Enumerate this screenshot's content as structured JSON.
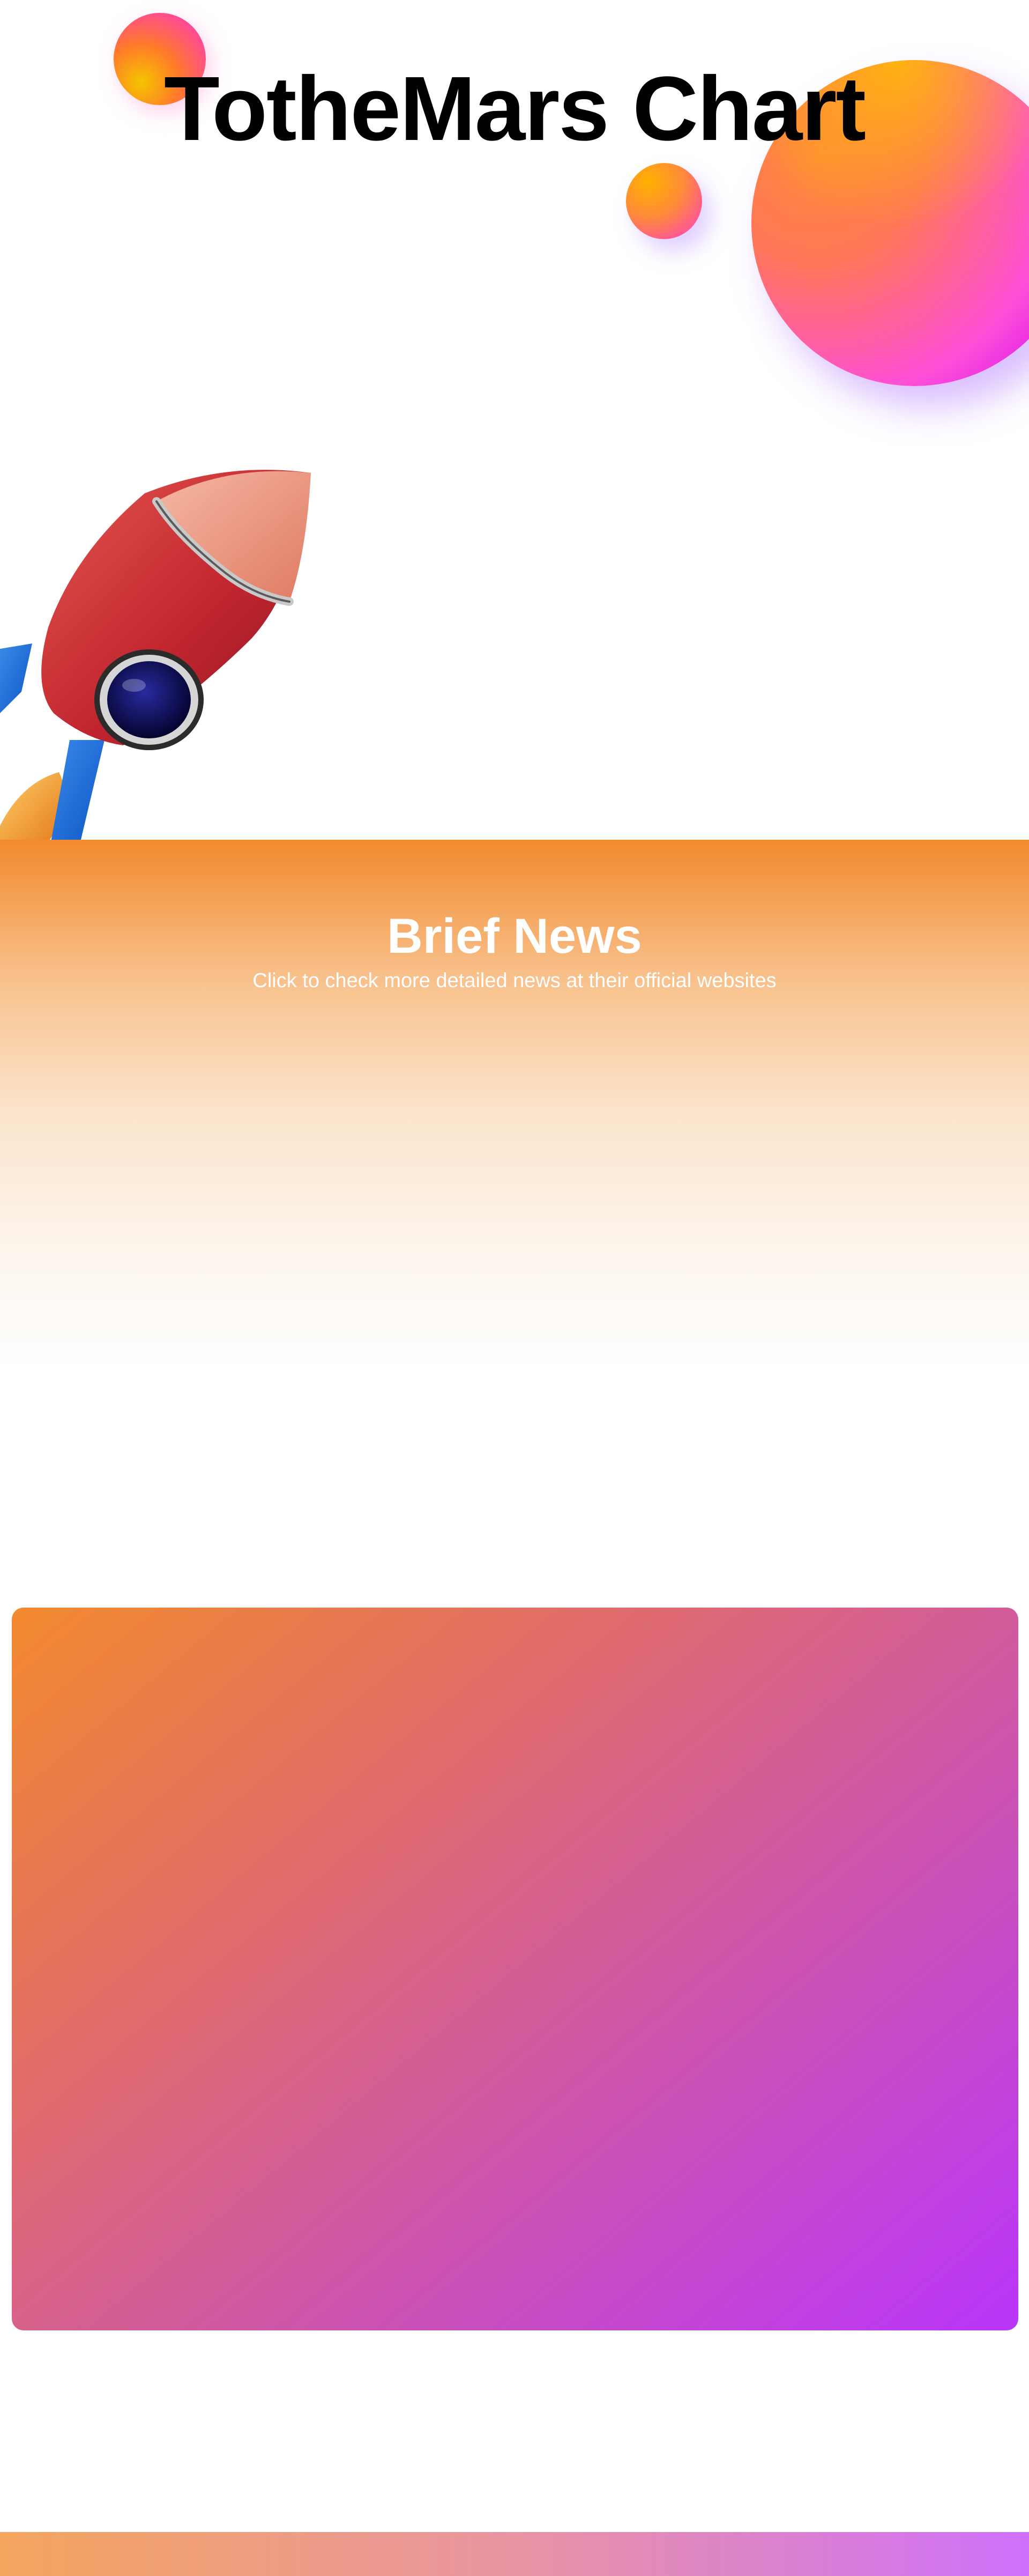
{
  "hero": {
    "title": "TotheMars Chart"
  },
  "news": {
    "title": "Brief News",
    "subtitle": "Click to check more detailed news at their official websites"
  },
  "colors": {
    "news_gradient_top": "#f28a2e",
    "card_gradient_start": "#f28a2e",
    "card_gradient_end": "#b935fb",
    "footer_gradient_start": "#f4a65e",
    "footer_gradient_end": "#cf70fb"
  },
  "icons": {
    "rocket": "rocket-illustration",
    "orbs": "decorative-gradient-spheres"
  }
}
